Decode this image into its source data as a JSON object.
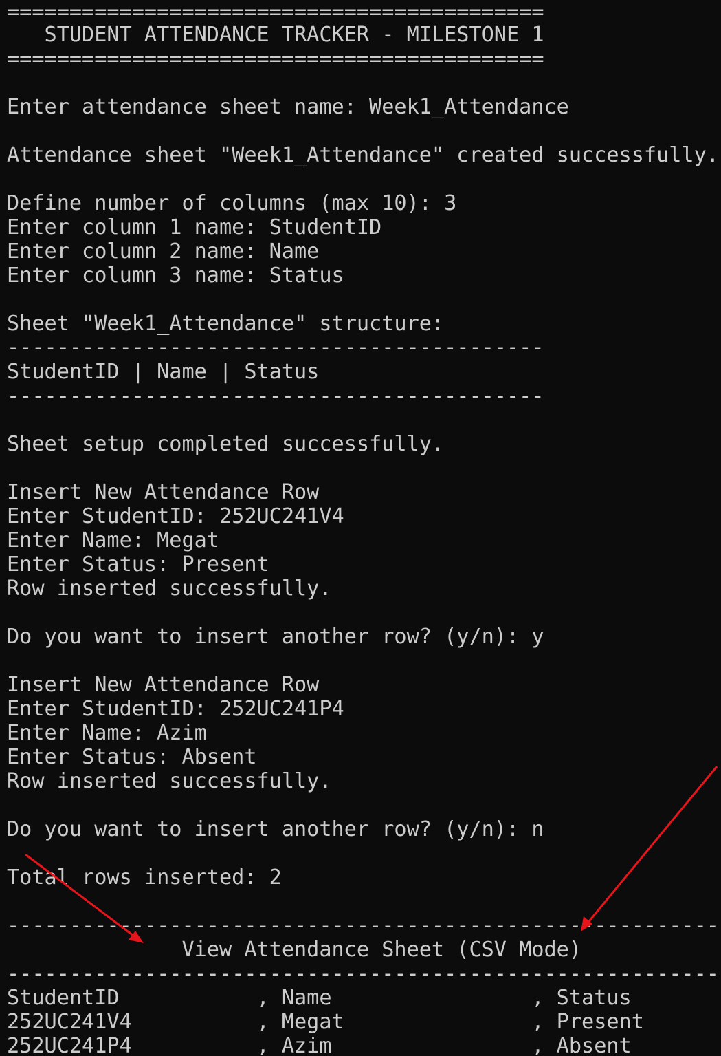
{
  "terminal": {
    "lines": [
      "===========================================",
      "   STUDENT ATTENDANCE TRACKER - MILESTONE 1",
      "===========================================",
      "",
      "Enter attendance sheet name: Week1_Attendance",
      "",
      "Attendance sheet \"Week1_Attendance\" created successfully.",
      "",
      "Define number of columns (max 10): 3",
      "Enter column 1 name: StudentID",
      "Enter column 2 name: Name",
      "Enter column 3 name: Status",
      "",
      "Sheet \"Week1_Attendance\" structure:",
      "-------------------------------------------",
      "StudentID | Name | Status",
      "-------------------------------------------",
      "",
      "Sheet setup completed successfully.",
      "",
      "Insert New Attendance Row",
      "Enter StudentID: 252UC241V4",
      "Enter Name: Megat",
      "Enter Status: Present",
      "Row inserted successfully.",
      "",
      "Do you want to insert another row? (y/n): y",
      "",
      "Insert New Attendance Row",
      "Enter StudentID: 252UC241P4",
      "Enter Name: Azim",
      "Enter Status: Absent",
      "Row inserted successfully.",
      "",
      "Do you want to insert another row? (y/n): n",
      "",
      "Total rows inserted: 2",
      "",
      "---------------------------------------------------------",
      "              View Attendance Sheet (CSV Mode)",
      "---------------------------------------------------------",
      "StudentID           , Name                , Status",
      "252UC241V4          , Megat               , Present",
      "252UC241P4          , Azim                , Absent"
    ]
  },
  "annotations": {
    "arrow_color": "#e8141b",
    "arrow_count": 2
  }
}
